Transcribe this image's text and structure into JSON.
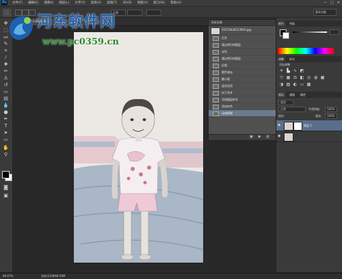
{
  "app": {
    "logo_text": "Ps"
  },
  "menubar": {
    "items": [
      "文件(F)",
      "编辑(E)",
      "图像(I)",
      "图层(L)",
      "文字(Y)",
      "选择(S)",
      "滤镜(T)",
      "3D(D)",
      "视图(V)",
      "窗口(W)",
      "帮助(H)"
    ],
    "window_buttons": [
      "—",
      "□",
      "✕"
    ]
  },
  "optionsbar": {
    "style_value": "正常",
    "workspace_value": "基本功能"
  },
  "document_tab": {
    "title": "20170628153916.jpg"
  },
  "history_panel": {
    "title": "历史记录",
    "snapshot_label": "20170628153916.jpg",
    "steps": [
      "打开",
      "通过拷贝的图层",
      "去色",
      "通过拷贝的图层",
      "反相",
      "颜色减淡",
      "最小值",
      "混合选项",
      "向下合并",
      "添加图层样式",
      "添加杂色",
      "动感模糊"
    ],
    "selected_index": 11
  },
  "color_panel": {
    "tabs": [
      "颜色",
      "色板"
    ]
  },
  "adjust_panel": {
    "tabs": [
      "调整",
      "样式"
    ],
    "subtitle": "添加调整"
  },
  "layers_panel": {
    "tabs": [
      "图层",
      "通道",
      "路径"
    ],
    "filter_label": "类型",
    "blend_mode": "正常",
    "opacity_label": "不透明度:",
    "opacity_value": "100%",
    "lock_label": "锁定:",
    "fill_label": "填充:",
    "fill_value": "100%",
    "layers": [
      {
        "name": "图层 1",
        "selected": true
      },
      {
        "name": "",
        "selected": false
      }
    ]
  },
  "statusbar": {
    "zoom": "66.67%",
    "doc_info": "文档:6.64M/6.59M",
    "tabs": [
      "Mini Bridge",
      "时间轴"
    ]
  },
  "watermark": {
    "site_name": "河东软件网",
    "url": "www.pc0359.cn"
  }
}
